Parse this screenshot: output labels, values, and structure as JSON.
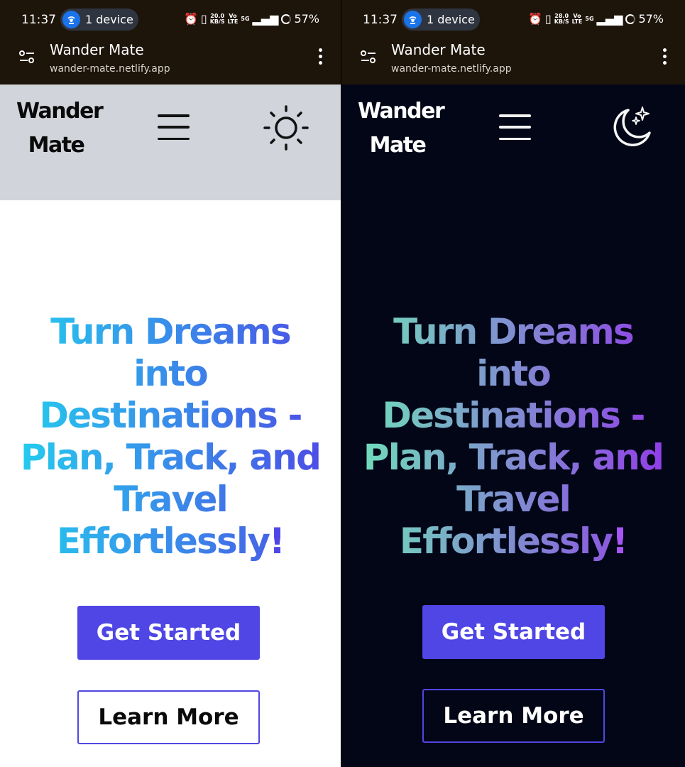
{
  "status_bar": {
    "left": {
      "time": "11:37",
      "hotspot_label": "1 device",
      "speed_value": "20.0",
      "speed_unit": "KB/S",
      "battery": "57%"
    },
    "right": {
      "time": "11:37",
      "hotspot_label": "1 device",
      "speed_value": "28.0",
      "speed_unit": "KB/S",
      "battery": "57%"
    },
    "volte_top": "Vo",
    "volte_bottom": "LTE",
    "network": "5G"
  },
  "browser": {
    "title": "Wander Mate",
    "url": "wander-mate.netlify.app"
  },
  "navbar": {
    "logo_line1": "Wander",
    "logo_line2": "Mate"
  },
  "hero": {
    "headline": "Turn Dreams into Destinations - Plan, Track, and Travel Effortlessly",
    "exclamation": "!",
    "primary_button": "Get Started",
    "secondary_button": "Learn More"
  },
  "theme": {
    "light": {
      "mode_icon": "sun-icon",
      "navbar_bg": "#d1d5db",
      "page_bg": "#ffffff",
      "gradient_start": "#22d3ee",
      "gradient_end": "#4f46e5"
    },
    "dark": {
      "mode_icon": "moon-stars-icon",
      "page_bg": "#020617",
      "gradient_start": "#6ee7b7",
      "gradient_end": "#9333ea"
    },
    "accent": "#4f46e5"
  }
}
